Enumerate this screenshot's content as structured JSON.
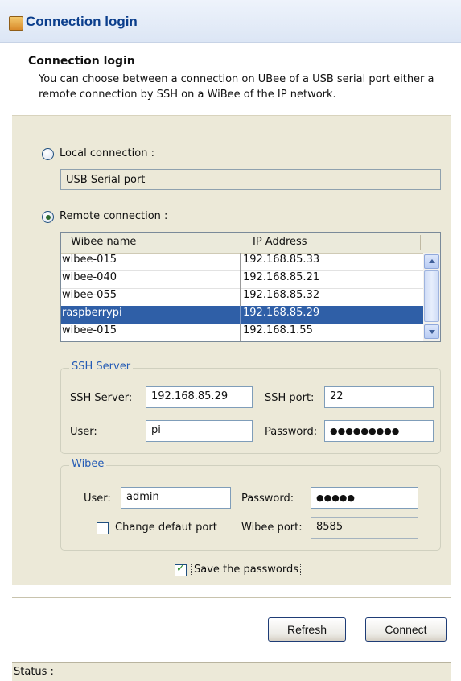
{
  "window": {
    "title": "Connection login"
  },
  "header": {
    "title": "Connection login",
    "description": "You can choose between a connection on UBee of a USB serial port either a remote connection by SSH on a WiBee of the IP network."
  },
  "local": {
    "label": "Local connection :",
    "value": "USB Serial port",
    "selected": false
  },
  "remote": {
    "label": "Remote connection :",
    "selected": true
  },
  "table": {
    "columns": [
      "Wibee name",
      "IP Address"
    ],
    "rows": [
      {
        "name": "wibee-015",
        "ip": "192.168.85.33"
      },
      {
        "name": "wibee-040",
        "ip": "192.168.85.21"
      },
      {
        "name": "wibee-055",
        "ip": "192.168.85.32"
      },
      {
        "name": "raspberrypi",
        "ip": "192.168.85.29"
      },
      {
        "name": "wibee-015",
        "ip": "192.168.1.55"
      }
    ],
    "selected_index": 3
  },
  "ssh": {
    "legend": "SSH Server",
    "server_label": "SSH Server:",
    "server_value": "192.168.85.29",
    "port_label": "SSH port:",
    "port_value": "22",
    "user_label": "User:",
    "user_value": "pi",
    "password_label": "Password:",
    "password_value": "●●●●●●●●●"
  },
  "wibee": {
    "legend": "Wibee",
    "user_label": "User:",
    "user_value": "admin",
    "password_label": "Password:",
    "password_value": "●●●●●",
    "change_port_label": "Change defaut port",
    "change_port_checked": false,
    "port_label": "Wibee port:",
    "port_value": "8585"
  },
  "save_passwords": {
    "label": "Save the passwords",
    "checked": true
  },
  "buttons": {
    "refresh": "Refresh",
    "connect": "Connect"
  },
  "status": {
    "label": "Status :"
  }
}
